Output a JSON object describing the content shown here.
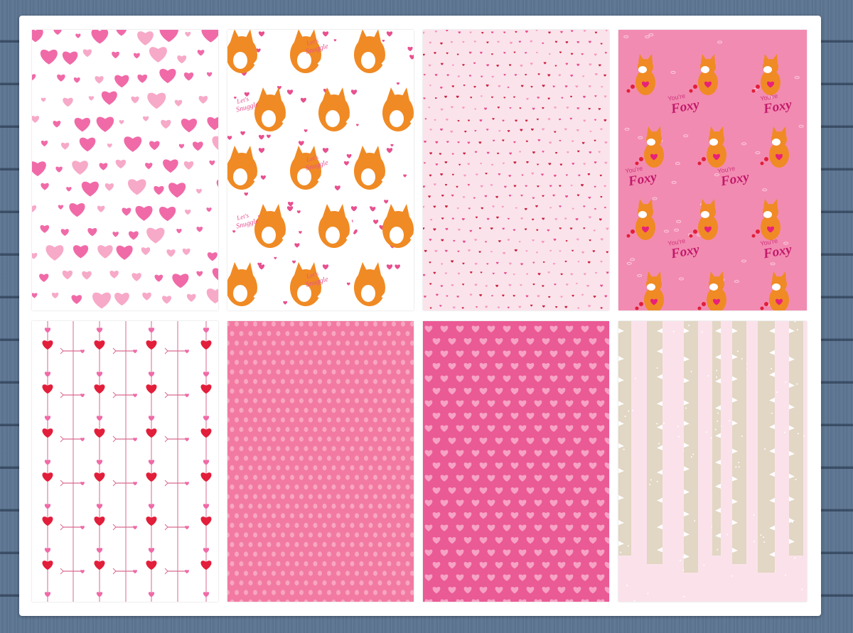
{
  "papers": [
    {
      "pattern": "hearts-scattered",
      "colors": {
        "bg": "#ffffff",
        "primary": "#f06aa8",
        "secondary": "#f7a9c8"
      }
    },
    {
      "pattern": "fox-snuggle",
      "colors": {
        "bg": "#ffffff",
        "fox": "#f08a24",
        "accent": "#e8508f"
      },
      "text": [
        "Let's",
        "Snuggle"
      ]
    },
    {
      "pattern": "tiny-hearts",
      "colors": {
        "bg": "#fbe3ec",
        "dots": [
          "#e8508f",
          "#c9243f",
          "#f59bbd"
        ]
      }
    },
    {
      "pattern": "fox-foxy",
      "colors": {
        "bg": "#f28bb1",
        "fox": "#f08a24",
        "text": "#c2186b"
      },
      "text": [
        "You're",
        "Foxy"
      ]
    },
    {
      "pattern": "heart-arrows",
      "colors": {
        "bg": "#ffffff",
        "red": "#e21e3a",
        "pink": "#f06aa8",
        "line": "#d96a8f"
      }
    },
    {
      "pattern": "polka-dots",
      "colors": {
        "bg": "#f27aa2",
        "dots": "#f8a6c0"
      }
    },
    {
      "pattern": "heart-grid",
      "colors": {
        "bg": "#ea5a95",
        "hearts": "#f6a2c4"
      }
    },
    {
      "pattern": "birch-trees",
      "colors": {
        "bg": "#fbe2ea",
        "bark": "#e2d6c4",
        "marks": "#ffffff"
      }
    }
  ]
}
